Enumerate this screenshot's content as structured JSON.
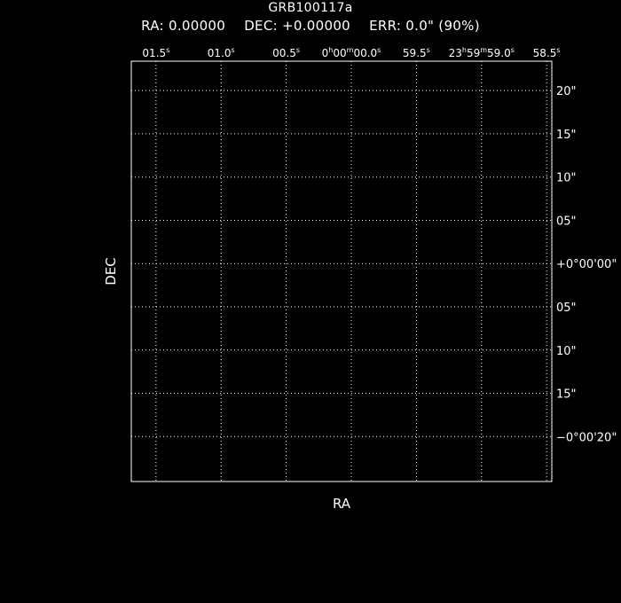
{
  "header": {
    "title": "GRB100117a",
    "ra_text": "RA: 0.00000",
    "dec_text": "DEC: +0.00000",
    "err_text": "ERR: 0.0\" (90%)"
  },
  "colors": {
    "background": "#000000",
    "foreground": "#ffffff"
  },
  "chart_data": {
    "type": "scatter",
    "title": "GRB100117a",
    "xlabel": "RA",
    "ylabel": "DEC",
    "grid": true,
    "grid_style": "dotted",
    "series": [],
    "x_axis": {
      "position": "top",
      "direction": "decreasing",
      "units": "seconds of RA",
      "ylim_note": "",
      "lim": [
        1.69,
        -1.54
      ],
      "ticks": [
        {
          "value": 1.5,
          "base": "01.5",
          "sup": "s"
        },
        {
          "value": 1.0,
          "base": "01.0",
          "sup": "s"
        },
        {
          "value": 0.5,
          "base": "00.5",
          "sup": "s"
        },
        {
          "value": 0.0,
          "parts": [
            [
              "0",
              ""
            ],
            [
              "h",
              "sup"
            ],
            [
              "00",
              ""
            ],
            [
              "m",
              "sup"
            ],
            [
              "00.0",
              ""
            ],
            [
              "s",
              "sup"
            ]
          ]
        },
        {
          "value": -0.5,
          "base": "59.5",
          "sup": "s"
        },
        {
          "value": -1.0,
          "parts": [
            [
              "23",
              ""
            ],
            [
              "h",
              "sup"
            ],
            [
              "59",
              ""
            ],
            [
              "m",
              "sup"
            ],
            [
              "59.0",
              ""
            ],
            [
              "s",
              "sup"
            ]
          ]
        },
        {
          "value": -1.5,
          "base": "58.5",
          "sup": "s"
        }
      ]
    },
    "y_axis": {
      "position": "right",
      "units": "arcseconds of DEC",
      "lim": [
        -25.2,
        23.4
      ],
      "ticks": [
        {
          "value": 20,
          "label": "20\""
        },
        {
          "value": 15,
          "label": "15\""
        },
        {
          "value": 10,
          "label": "10\""
        },
        {
          "value": 5,
          "label": "05\""
        },
        {
          "value": 0,
          "label": "+0°00'00\""
        },
        {
          "value": -5,
          "label": "05\""
        },
        {
          "value": -10,
          "label": "10\""
        },
        {
          "value": -15,
          "label": "15\""
        },
        {
          "value": -20,
          "label": "−0°00'20\""
        }
      ]
    }
  }
}
